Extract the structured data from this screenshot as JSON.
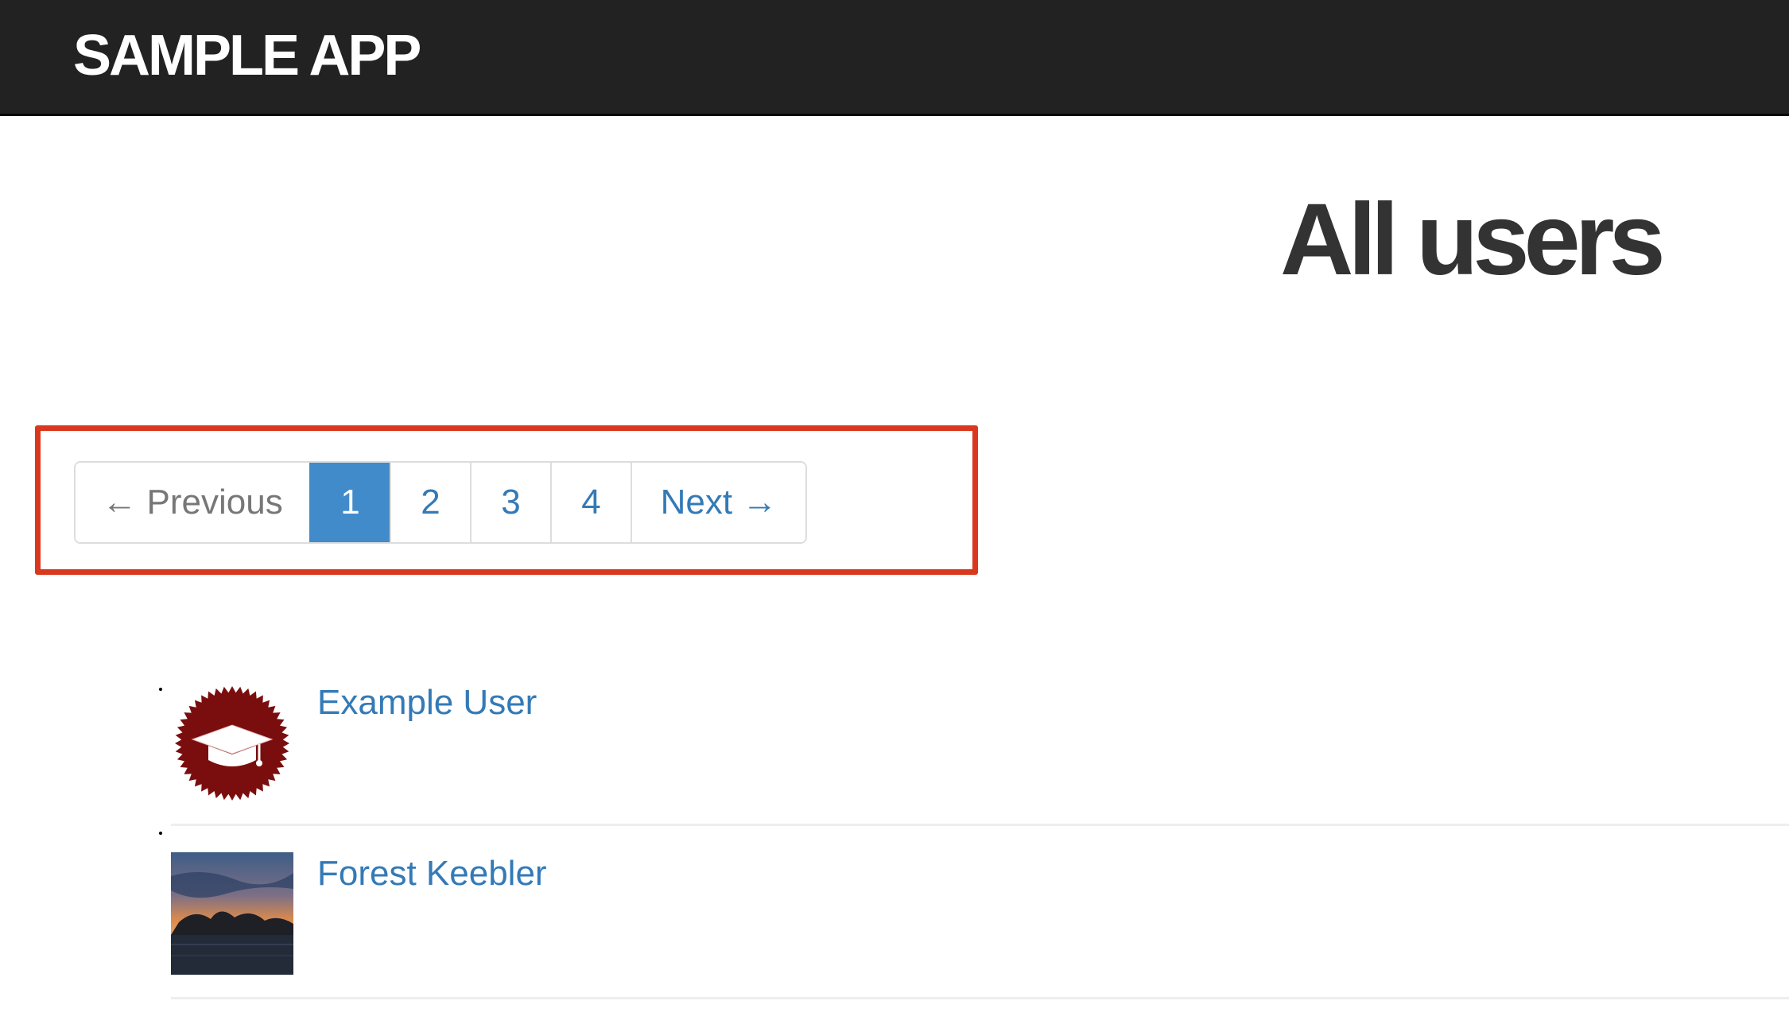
{
  "header": {
    "brand": "SAMPLE APP"
  },
  "main": {
    "title": "All users"
  },
  "pagination": {
    "previous_label": "← Previous",
    "pages": [
      "1",
      "2",
      "3",
      "4"
    ],
    "active_page": "1",
    "next_label": "Next →"
  },
  "users": [
    {
      "name": "Example User",
      "avatar": "graduation-cap-badge-icon"
    },
    {
      "name": "Forest Keebler",
      "avatar": "sunset-photo"
    }
  ],
  "colors": {
    "navbar": "#222222",
    "link": "#337ab7",
    "active_page": "#428bca",
    "highlight": "#d9381e",
    "badge": "#7a0e0e"
  }
}
